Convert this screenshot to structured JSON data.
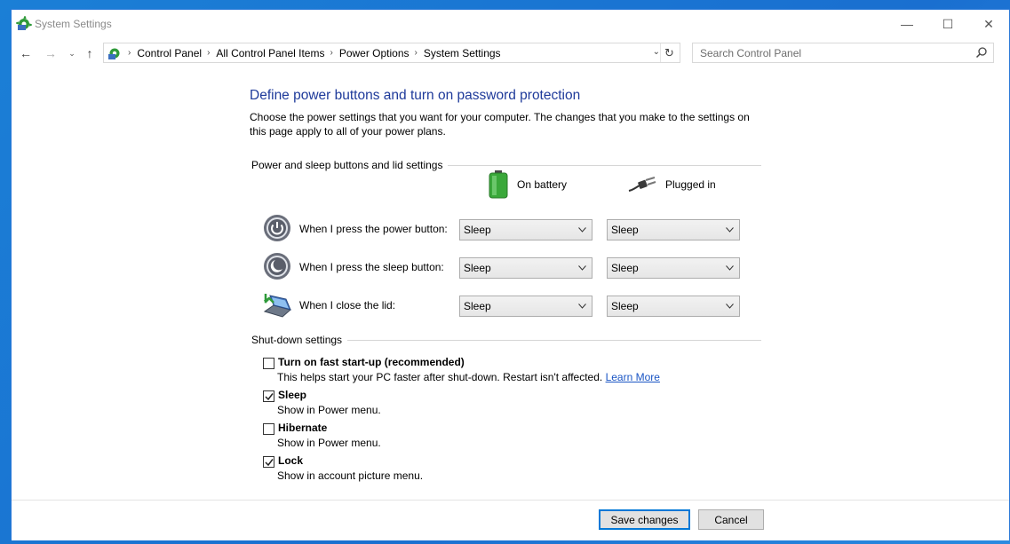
{
  "window": {
    "title": "System Settings",
    "controls": {
      "minimize": "—",
      "maximize": "☐",
      "close": "✕"
    }
  },
  "nav": {
    "back": "←",
    "forward": "→",
    "recent": "⌄",
    "up": "↑",
    "breadcrumb": [
      "Control Panel",
      "All Control Panel Items",
      "Power Options",
      "System Settings"
    ],
    "separator": "›",
    "dropdown": "⌄",
    "refresh": "↻",
    "search_placeholder": "Search Control Panel"
  },
  "page": {
    "heading": "Define power buttons and turn on password protection",
    "description": "Choose the power settings that you want for your computer. The changes that you make to the settings on this page apply to all of your power plans."
  },
  "power_section": {
    "title": "Power and sleep buttons and lid settings",
    "col_battery": "On battery",
    "col_plugged": "Plugged in",
    "rows": [
      {
        "label": "When I press the power button:",
        "battery": "Sleep",
        "plugged": "Sleep",
        "icon": "power-button-icon"
      },
      {
        "label": "When I press the sleep button:",
        "battery": "Sleep",
        "plugged": "Sleep",
        "icon": "sleep-button-icon"
      },
      {
        "label": "When I close the lid:",
        "battery": "Sleep",
        "plugged": "Sleep",
        "icon": "laptop-lid-icon"
      }
    ]
  },
  "shutdown_section": {
    "title": "Shut-down settings",
    "options": [
      {
        "label": "Turn on fast start-up (recommended)",
        "desc": "This helps start your PC faster after shut-down. Restart isn't affected.",
        "link": "Learn More",
        "checked": false
      },
      {
        "label": "Sleep",
        "desc": "Show in Power menu.",
        "checked": true
      },
      {
        "label": "Hibernate",
        "desc": "Show in Power menu.",
        "checked": false
      },
      {
        "label": "Lock",
        "desc": "Show in account picture menu.",
        "checked": true
      }
    ]
  },
  "footer": {
    "save": "Save changes",
    "cancel": "Cancel"
  },
  "colors": {
    "heading": "#1e3a9a",
    "link": "#1a55c4",
    "accent": "#0078d7",
    "desktop": "#1a6fd0"
  }
}
